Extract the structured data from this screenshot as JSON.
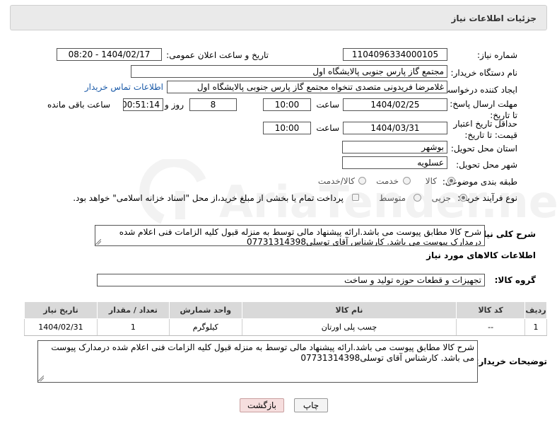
{
  "header": {
    "title": "جزئیات اطلاعات نیاز"
  },
  "form": {
    "need_number": {
      "label": "شماره نیاز:",
      "value": "1104096334000105"
    },
    "announce_datetime": {
      "label": "تاریخ و ساعت اعلان عمومی:",
      "value": "1404/02/17 - 08:20"
    },
    "buyer_org": {
      "label": "نام دستگاه خریدار:",
      "value": "مجتمع گاز پارس جنوبی  پالایشگاه اول"
    },
    "requester": {
      "label": "ایجاد کننده درخواست:",
      "value": "غلامرضا فریدونی متصدی تنخواه مجتمع گاز پارس جنوبی  پالایشگاه اول",
      "link": "اطلاعات تماس خریدار"
    },
    "reply_deadline": {
      "label": "مهلت ارسال پاسخ: تا تاریخ:",
      "date": "1404/02/25",
      "time_label": "ساعت",
      "time": "10:00",
      "days": "8",
      "days_label": "روز و",
      "remaining": "00:51:14",
      "remaining_label": "ساعت باقی مانده"
    },
    "price_validity": {
      "label": "حداقل تاریخ اعتبار قیمت: تا تاریخ:",
      "date": "1404/03/31",
      "time_label": "ساعت",
      "time": "10:00"
    },
    "province": {
      "label": "استان محل تحویل:",
      "value": "بوشهر"
    },
    "city": {
      "label": "شهر محل تحویل:",
      "value": "عسلویه"
    },
    "category": {
      "label": "طبقه بندی موضوعی:",
      "options": [
        "کالا",
        "خدمت",
        "کالا/خدمت"
      ],
      "selected": "کالا"
    },
    "purchase_type": {
      "label": "نوع فرآیند خرید :",
      "options": [
        "جزیی",
        "متوسط"
      ],
      "selected": "جزیی",
      "note": "پرداخت تمام یا بخشی از مبلغ خرید،از محل \"اسناد خزانه اسلامی\" خواهد بود."
    },
    "description": {
      "label": "شرح کلی نیاز:",
      "value": "شرح کالا مطابق پیوست می باشد.ارائه پیشنهاد مالی توسط  به منزله قبول کلیه الزامات فنی اعلام شده درمدارک پیوست می باشد. کارشناس آقای توسلی07731314398"
    }
  },
  "goods": {
    "section_title": "اطلاعات کالاهای مورد نیاز",
    "group_label": "گروه کالا:",
    "group_value": "تجهیزات و قطعات حوزه تولید و ساخت",
    "columns": [
      "ردیف",
      "کد کالا",
      "نام کالا",
      "واحد شمارش",
      "تعداد / مقدار",
      "تاریخ نیاز"
    ],
    "rows": [
      {
        "index": "1",
        "code": "--",
        "name": "چسب پلی اورتان",
        "unit": "کیلوگرم",
        "qty": "1",
        "date": "1404/02/31"
      }
    ]
  },
  "buyer_notes": {
    "label": "توضیحات خریدار:",
    "value": "شرح کالا مطابق پیوست می باشد.ارائه پیشنهاد مالی توسط  به منزله قبول کلیه الزامات فنی اعلام شده درمدارک پیوست می باشد. کارشناس آقای توسلی07731314398"
  },
  "actions": {
    "print": "چاپ",
    "back": "بازگشت"
  },
  "watermark": {
    "text": "AriaTender.neT"
  }
}
